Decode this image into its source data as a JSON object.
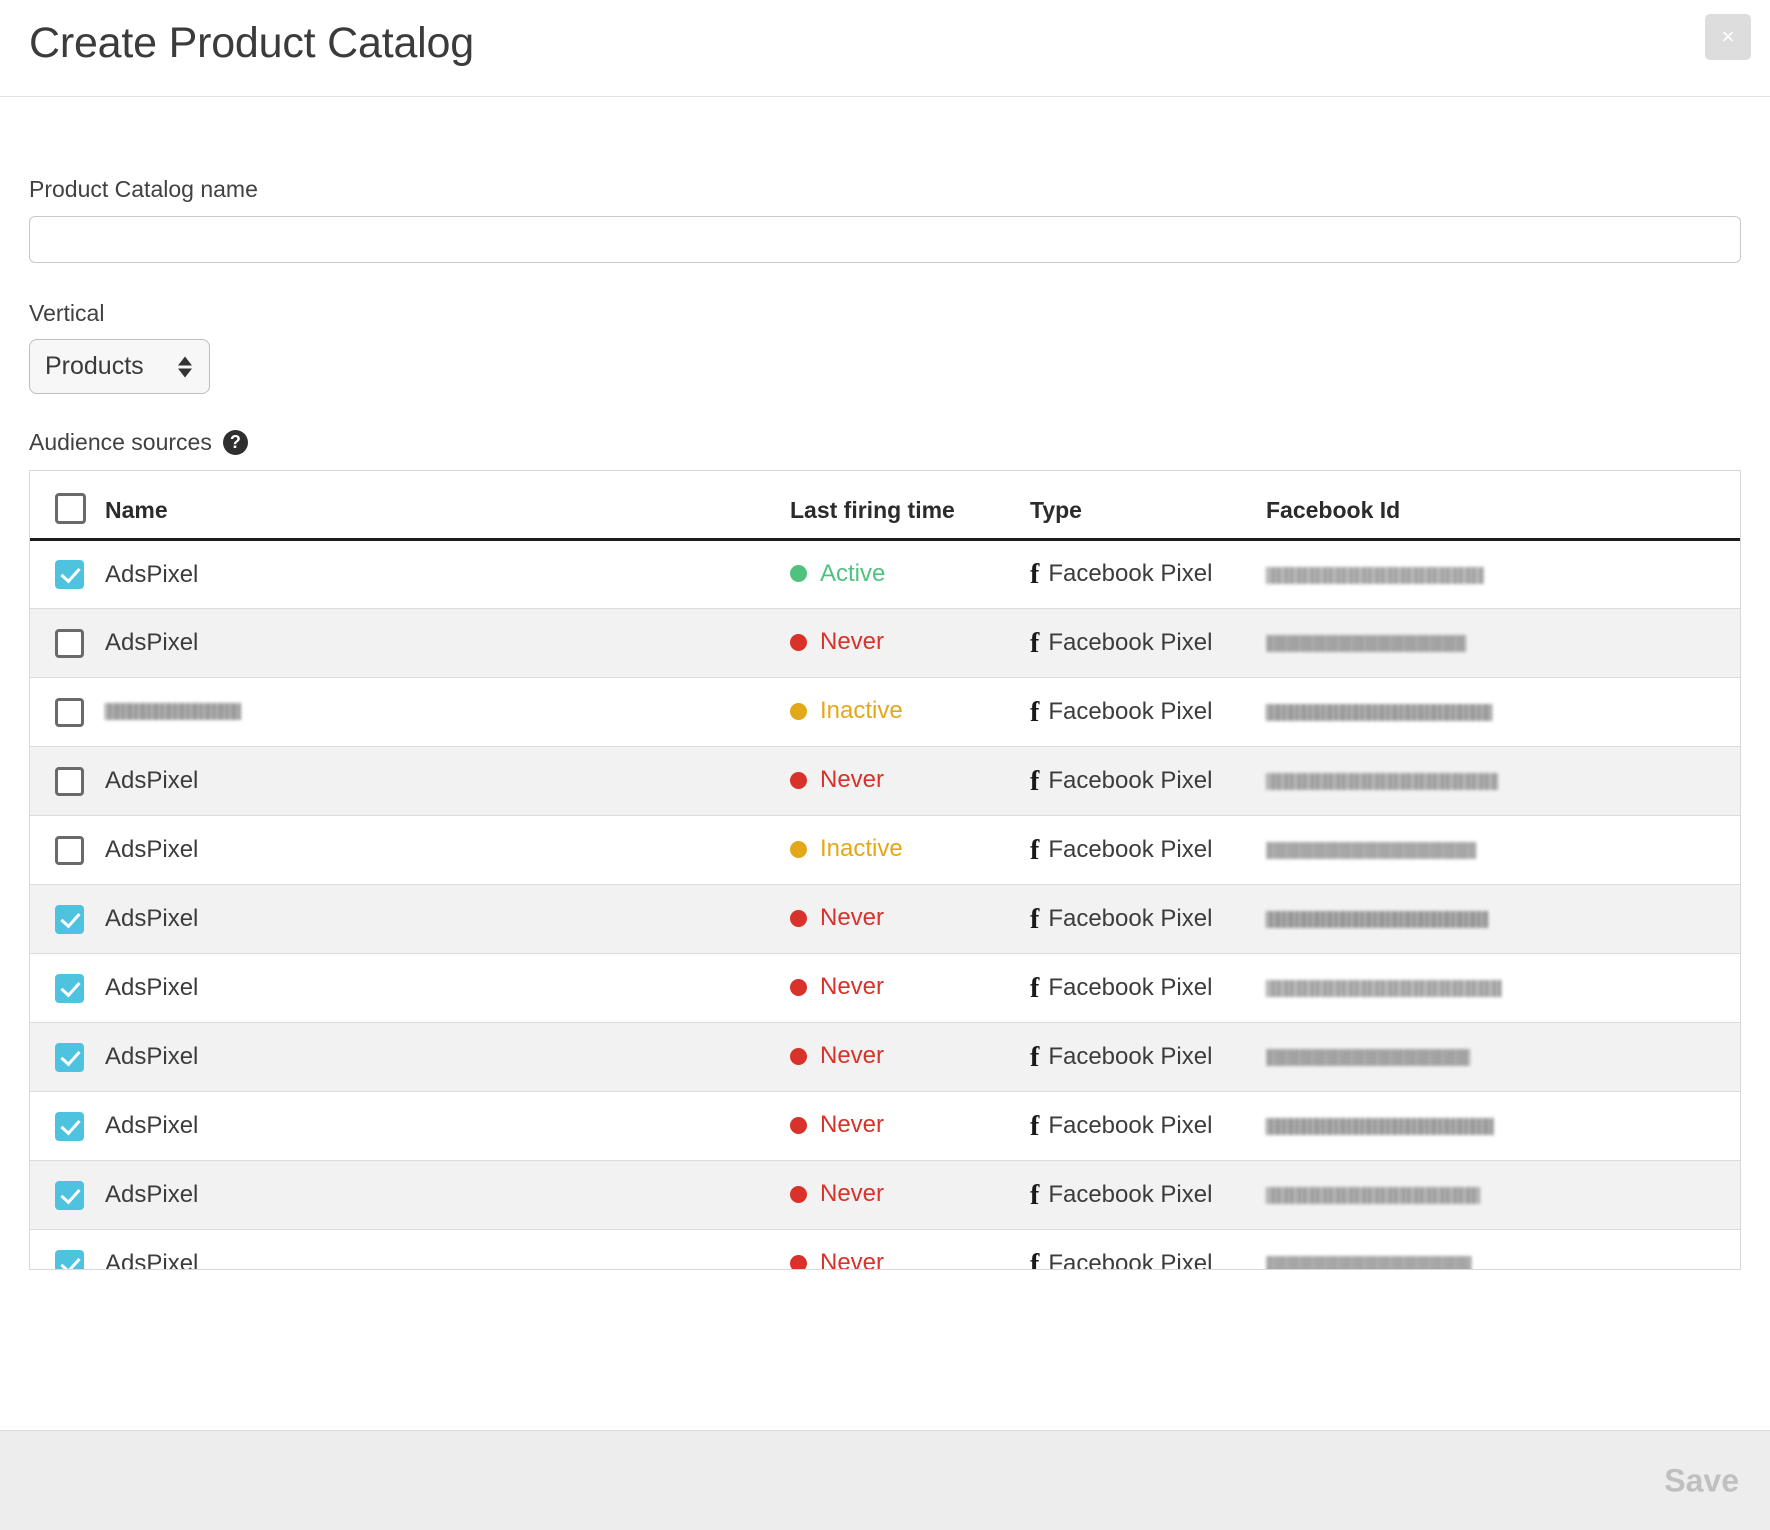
{
  "dialog": {
    "title": "Create Product Catalog",
    "close_label": "×"
  },
  "form": {
    "catalog_name": {
      "label": "Product Catalog name",
      "value": "",
      "placeholder": ""
    },
    "vertical": {
      "label": "Vertical",
      "selected": "Products",
      "options": [
        "Products"
      ]
    },
    "audience_sources": {
      "label": "Audience sources",
      "help_icon": "question-mark-icon",
      "help_glyph": "?"
    }
  },
  "table": {
    "columns": [
      "Name",
      "Last firing time",
      "Type",
      "Facebook Id"
    ],
    "select_all_checked": false,
    "rows": [
      {
        "checked": true,
        "name": "AdsPixel",
        "name_redacted": false,
        "status": "Active",
        "status_color": "#4ec27e",
        "type": "Facebook Pixel",
        "facebook_id": "",
        "fbid_redacted": true,
        "striped": false
      },
      {
        "checked": false,
        "name": "AdsPixel",
        "name_redacted": false,
        "status": "Never",
        "status_color": "#d9322a",
        "type": "Facebook Pixel",
        "facebook_id": "",
        "fbid_redacted": true,
        "striped": true
      },
      {
        "checked": false,
        "name": "",
        "name_redacted": true,
        "status": "Inactive",
        "status_color": "#e3a71a",
        "type": "Facebook Pixel",
        "facebook_id": "",
        "fbid_redacted": true,
        "striped": false
      },
      {
        "checked": false,
        "name": "AdsPixel",
        "name_redacted": false,
        "status": "Never",
        "status_color": "#d9322a",
        "type": "Facebook Pixel",
        "facebook_id": "",
        "fbid_redacted": true,
        "striped": true
      },
      {
        "checked": false,
        "name": "AdsPixel",
        "name_redacted": false,
        "status": "Inactive",
        "status_color": "#e3a71a",
        "type": "Facebook Pixel",
        "facebook_id": "",
        "fbid_redacted": true,
        "striped": false
      },
      {
        "checked": true,
        "name": "AdsPixel",
        "name_redacted": false,
        "status": "Never",
        "status_color": "#d9322a",
        "type": "Facebook Pixel",
        "facebook_id": "",
        "fbid_redacted": true,
        "striped": true
      },
      {
        "checked": true,
        "name": "AdsPixel",
        "name_redacted": false,
        "status": "Never",
        "status_color": "#d9322a",
        "type": "Facebook Pixel",
        "facebook_id": "",
        "fbid_redacted": true,
        "striped": false
      },
      {
        "checked": true,
        "name": "AdsPixel",
        "name_redacted": false,
        "status": "Never",
        "status_color": "#d9322a",
        "type": "Facebook Pixel",
        "facebook_id": "",
        "fbid_redacted": true,
        "striped": true
      },
      {
        "checked": true,
        "name": "AdsPixel",
        "name_redacted": false,
        "status": "Never",
        "status_color": "#d9322a",
        "type": "Facebook Pixel",
        "facebook_id": "",
        "fbid_redacted": true,
        "striped": false
      },
      {
        "checked": true,
        "name": "AdsPixel",
        "name_redacted": false,
        "status": "Never",
        "status_color": "#d9322a",
        "type": "Facebook Pixel",
        "facebook_id": "",
        "fbid_redacted": true,
        "striped": true
      },
      {
        "checked": true,
        "name": "AdsPixel",
        "name_redacted": false,
        "status": "Never",
        "status_color": "#d9322a",
        "type": "Facebook Pixel",
        "facebook_id": "",
        "fbid_redacted": true,
        "striped": false
      }
    ]
  },
  "footer": {
    "save_label": "Save",
    "save_enabled": false
  },
  "colors": {
    "accent_checkbox": "#4ec3e0",
    "status_active": "#4ec27e",
    "status_never": "#d9322a",
    "status_inactive": "#e3a71a",
    "footer_bg": "#ededed",
    "save_disabled": "#c0c0c0"
  }
}
